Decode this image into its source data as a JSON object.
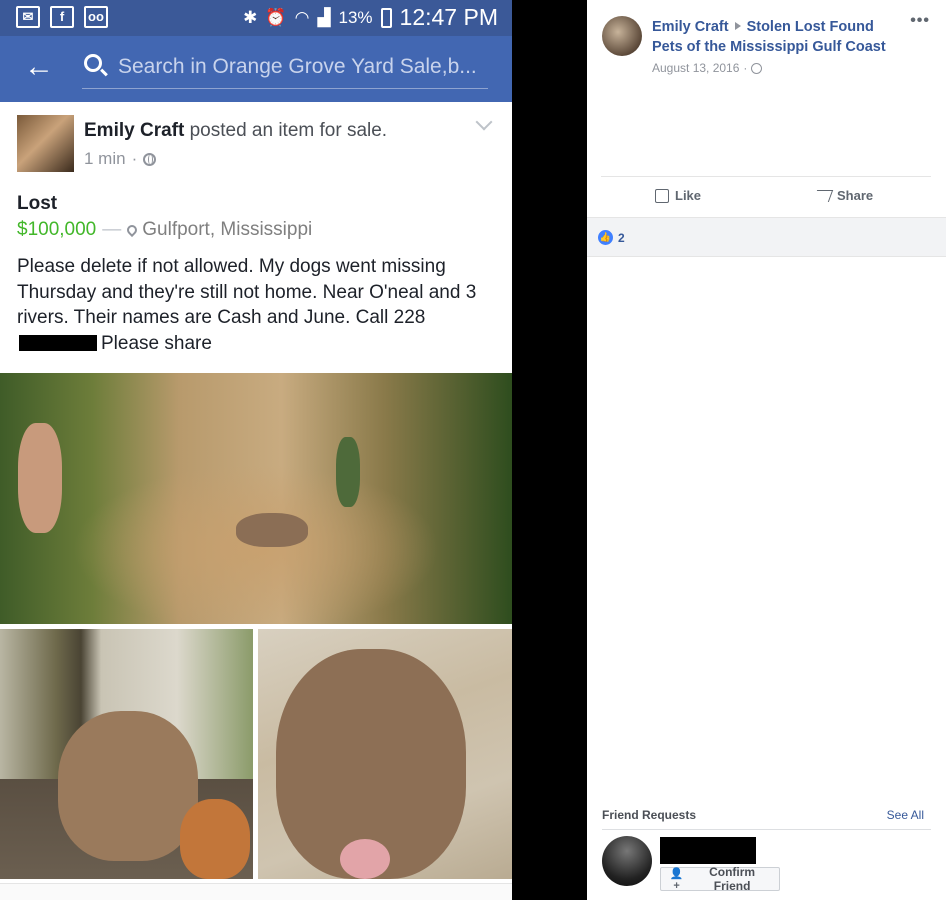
{
  "mobile": {
    "status_bar": {
      "left_icons": [
        "mail-icon",
        "facebook-icon",
        "voicemail-icon"
      ],
      "right_icons": [
        "bluetooth-icon",
        "alarm-icon",
        "wifi-icon",
        "signal-icon"
      ],
      "battery": "13%",
      "time": "12:47 PM"
    },
    "search": {
      "placeholder": "Search in Orange Grove Yard Sale,b..."
    },
    "post": {
      "author": "Emily Craft",
      "action": "posted an item for sale.",
      "time": "1 min",
      "item_title": "Lost",
      "price": "$100,000",
      "location": "Gulfport, Mississippi",
      "body_before_redaction": "Please delete if not allowed.  My dogs went missing Thursday and they're still not home.  Near O'neal and 3 rivers. Their names are Cash and June. Call 228",
      "body_after_redaction": "Please share"
    }
  },
  "desktop": {
    "author": "Emily Craft",
    "group": "Stolen Lost Found Pets of the Mississippi Gulf Coast",
    "date": "August 13, 2016",
    "more_label": "•••",
    "actions": {
      "like": "Like",
      "share": "Share"
    },
    "reactions": {
      "count": "2"
    },
    "friend_requests": {
      "title": "Friend Requests",
      "see_all": "See All",
      "confirm_label": "Confirm Friend"
    }
  },
  "colors": {
    "facebook_blue": "#3b5998",
    "search_bar": "#4267b2",
    "price_green": "#42b72a",
    "link_blue": "#365899"
  }
}
